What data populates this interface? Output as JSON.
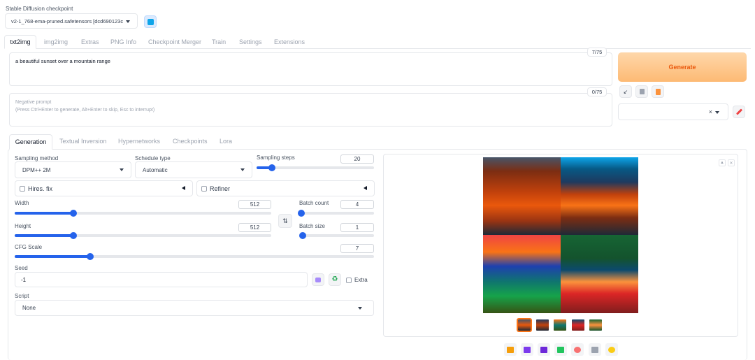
{
  "checkpoint": {
    "label": "Stable Diffusion checkpoint",
    "value": "v2-1_768-ema-pruned.safetensors [dcd690123c"
  },
  "main_tabs": [
    {
      "label": "txt2img",
      "active": true
    },
    {
      "label": "img2img"
    },
    {
      "label": "Extras"
    },
    {
      "label": "PNG Info"
    },
    {
      "label": "Checkpoint Merger"
    },
    {
      "label": "Train"
    },
    {
      "label": "Settings"
    },
    {
      "label": "Extensions"
    }
  ],
  "prompt": {
    "value": "a beautiful sunset over a mountain range",
    "token_count": "7/75"
  },
  "negative_prompt": {
    "placeholder_line1": "Negative prompt",
    "placeholder_line2": "(Press Ctrl+Enter to generate, Alt+Enter to skip, Esc to interrupt)",
    "token_count": "0/75"
  },
  "generate": {
    "label": "Generate"
  },
  "styles": {
    "clear": "×"
  },
  "sub_tabs": [
    {
      "label": "Generation",
      "active": true
    },
    {
      "label": "Textual Inversion"
    },
    {
      "label": "Hypernetworks"
    },
    {
      "label": "Checkpoints"
    },
    {
      "label": "Lora"
    }
  ],
  "sampling": {
    "method_label": "Sampling method",
    "method_value": "DPM++ 2M",
    "schedule_label": "Schedule type",
    "schedule_value": "Automatic",
    "steps_label": "Sampling steps",
    "steps_value": "20",
    "steps_fraction": 0.13
  },
  "hires": {
    "label": "Hires. fix"
  },
  "refiner": {
    "label": "Refiner"
  },
  "width": {
    "label": "Width",
    "value": "512",
    "fraction": 0.23
  },
  "height": {
    "label": "Height",
    "value": "512",
    "fraction": 0.23
  },
  "batch_count": {
    "label": "Batch count",
    "value": "4",
    "fraction": 0.03
  },
  "batch_size": {
    "label": "Batch size",
    "value": "1",
    "fraction": 0.0
  },
  "cfg": {
    "label": "CFG Scale",
    "value": "7",
    "fraction": 0.21
  },
  "seed": {
    "label": "Seed",
    "value": "-1",
    "extra_label": "Extra"
  },
  "script": {
    "label": "Script",
    "value": "None"
  },
  "output": {
    "toolbar_icons": [
      "folder-icon",
      "save-icon",
      "zip-icon",
      "send-to-img2img-icon",
      "send-to-inpaint-icon",
      "send-to-extras-icon",
      "sparkle-icon"
    ]
  }
}
